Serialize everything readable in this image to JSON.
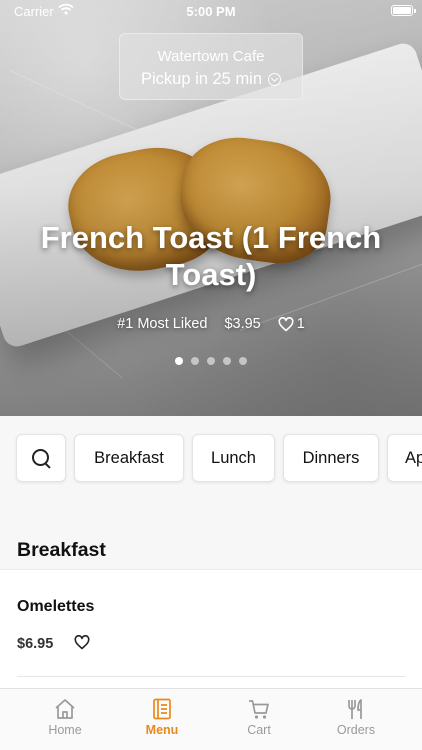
{
  "status_bar": {
    "carrier": "Carrier",
    "time": "5:00 PM"
  },
  "location": {
    "name": "Watertown Cafe",
    "pickup": "Pickup in 25 min"
  },
  "featured": {
    "title": "French Toast (1 French Toast)",
    "rank": "#1 Most Liked",
    "price": "$3.95",
    "likes": "1",
    "slides_total": 5,
    "active_slide": 1
  },
  "categories": [
    "Breakfast",
    "Lunch",
    "Dinners",
    "Ap"
  ],
  "section": {
    "title": "Breakfast"
  },
  "items": [
    {
      "name": "Omelettes",
      "price": "$6.95"
    }
  ],
  "tabs": [
    {
      "label": "Home",
      "icon": "home-icon",
      "active": false
    },
    {
      "label": "Menu",
      "icon": "menu-icon",
      "active": true
    },
    {
      "label": "Cart",
      "icon": "cart-icon",
      "active": false
    },
    {
      "label": "Orders",
      "icon": "fork-knife-icon",
      "active": false
    }
  ],
  "colors": {
    "accent": "#e88a1a",
    "inactive_tab": "#9a9a9a"
  }
}
